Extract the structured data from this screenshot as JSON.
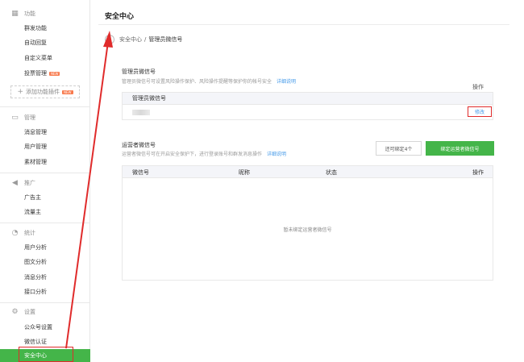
{
  "sidebar": {
    "sections": [
      {
        "key": "feature",
        "title": "功能",
        "icon": "grid-icon",
        "items": [
          "群发功能",
          "自动回复",
          "自定义菜单",
          "投票管理"
        ]
      },
      {
        "key": "manage",
        "title": "管理",
        "icon": "chat-icon",
        "items": [
          "消息管理",
          "用户管理",
          "素材管理"
        ]
      },
      {
        "key": "promo",
        "title": "推广",
        "icon": "megaphone-icon",
        "items": [
          "广告主",
          "流量主"
        ]
      },
      {
        "key": "stats",
        "title": "统计",
        "icon": "pie-chart-icon",
        "items": [
          "用户分析",
          "图文分析",
          "消息分析",
          "接口分析"
        ]
      },
      {
        "key": "settings",
        "title": "设置",
        "icon": "gear-icon",
        "items": [
          "公众号设置",
          "微信认证",
          "安全中心"
        ]
      }
    ],
    "new_badge": "NEW",
    "add_plugin": "添加功能插件",
    "active_item": "安全中心"
  },
  "main": {
    "page_title": "安全中心",
    "breadcrumb": {
      "parent": "安全中心",
      "sep": "/",
      "current": "管理员微信号"
    },
    "admin": {
      "title": "管理员微信号",
      "desc": "管理员微信号可设置风险操作保护、风险操作提醒等保护你的帐号安全",
      "link": "详细说明",
      "col_ops": "操作",
      "col_wechat": "管理员微信号",
      "modify": "修改"
    },
    "operator": {
      "title": "运营者微信号",
      "desc": "运营者微信号可在开启安全保护下，进行登录账号和群发消息操作",
      "link": "详细说明",
      "limit": "还可绑定4个",
      "bind": "绑定运营者微信号",
      "columns": [
        "微信号",
        "昵称",
        "状态",
        "操作"
      ],
      "empty": "暂未绑定运营者微信号"
    }
  },
  "colors": {
    "accent": "#44b549",
    "annotation": "#e02b2b",
    "link": "#459ae9"
  }
}
